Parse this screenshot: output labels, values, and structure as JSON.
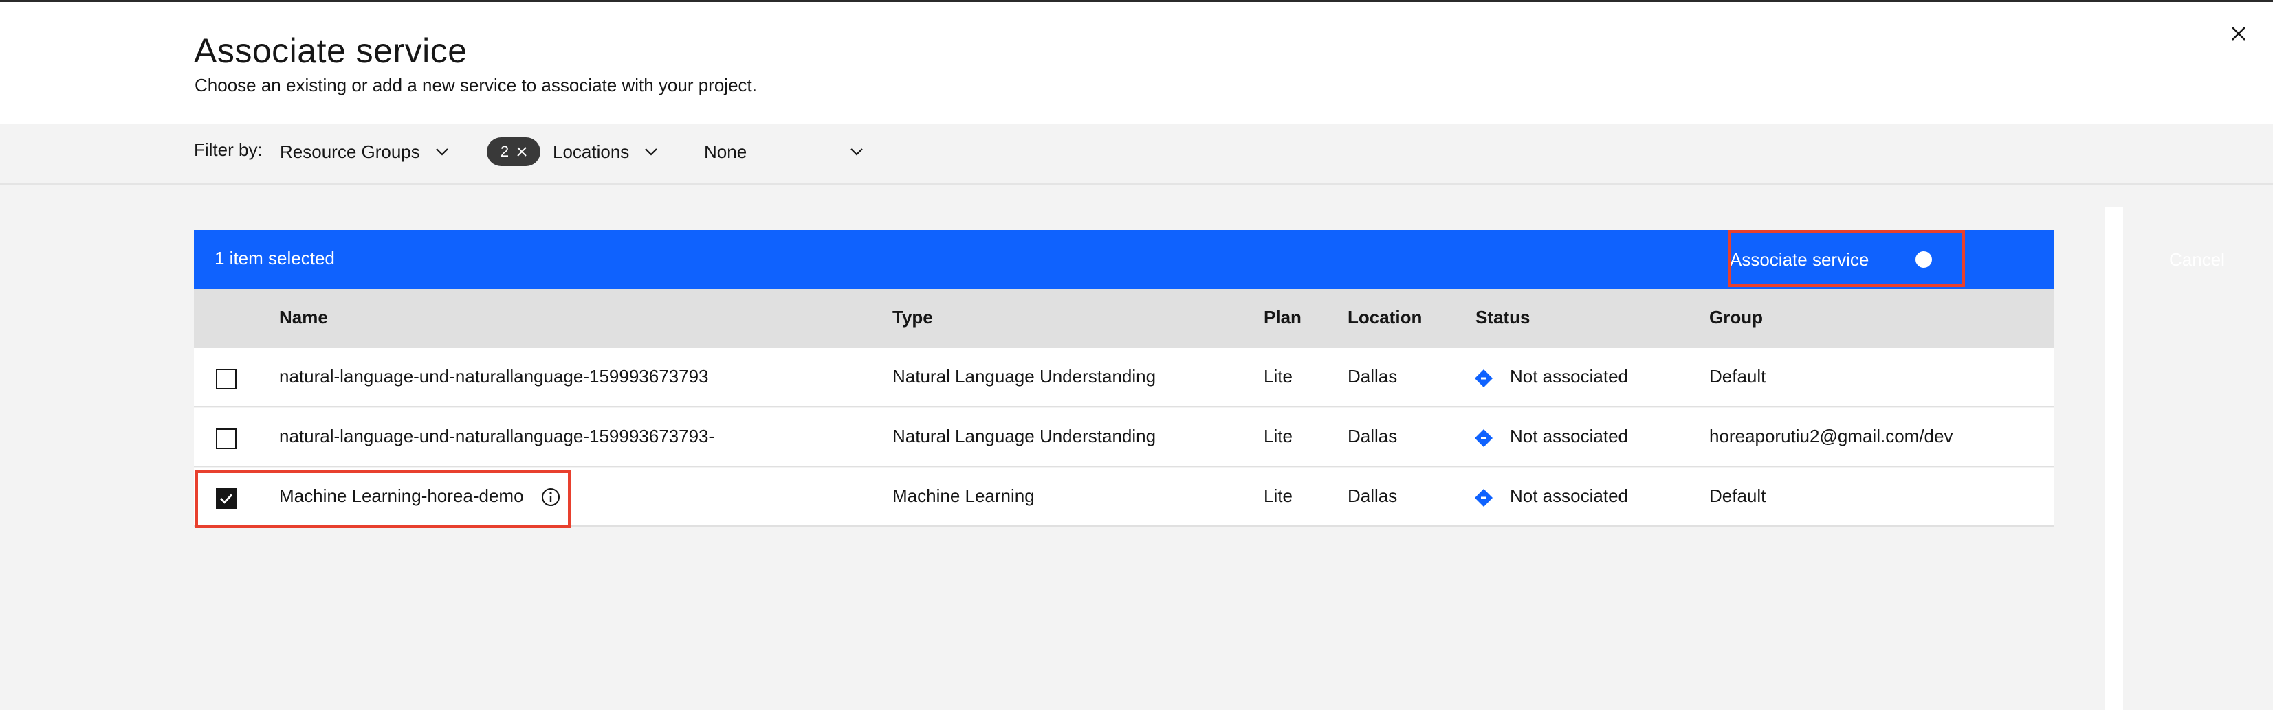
{
  "dialog": {
    "title": "Associate service",
    "subtitle": "Choose an existing or add a new service to associate with your project."
  },
  "filters": {
    "label": "Filter by:",
    "resource_groups": "Resource Groups",
    "locations_count": "2",
    "locations": "Locations",
    "none": "None"
  },
  "batch": {
    "selected_text": "1 item selected",
    "associate_label": "Associate service",
    "cancel_label": "Cancel"
  },
  "table": {
    "headers": {
      "name": "Name",
      "type": "Type",
      "plan": "Plan",
      "location": "Location",
      "status": "Status",
      "group": "Group"
    },
    "rows": [
      {
        "name": "natural-language-und-naturallanguage-159993673793",
        "type": "Natural Language Understanding",
        "plan": "Lite",
        "location": "Dallas",
        "status": "Not associated",
        "group": "Default",
        "checked": false
      },
      {
        "name": "natural-language-und-naturallanguage-159993673793-",
        "type": "Natural Language Understanding",
        "plan": "Lite",
        "location": "Dallas",
        "status": "Not associated",
        "group": "horeaporutiu2@gmail.com/dev",
        "checked": false
      },
      {
        "name": "Machine Learning-horea-demo",
        "type": "Machine Learning",
        "plan": "Lite",
        "location": "Dallas",
        "status": "Not associated",
        "group": "Default",
        "checked": true
      }
    ]
  },
  "colors": {
    "primary": "#0f62fe",
    "highlight": "#e8402e",
    "status_icon": "#0f62fe"
  }
}
